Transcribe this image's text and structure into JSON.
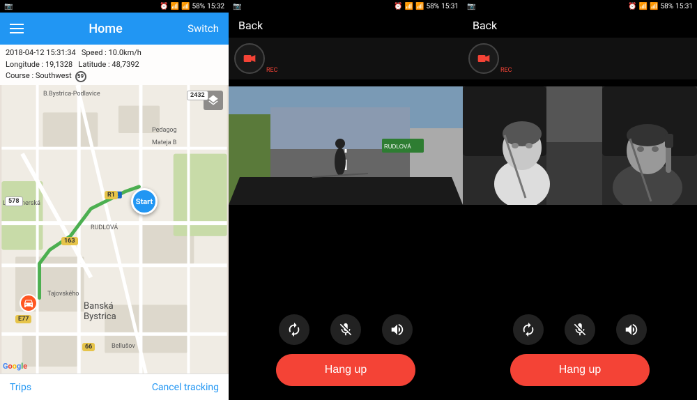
{
  "panel_map": {
    "status_bar": {
      "left": "",
      "time": "15:32",
      "battery": "58%"
    },
    "app_bar": {
      "title": "Home",
      "switch_label": "Switch"
    },
    "info": {
      "datetime": "2018-04-12  15:31:34",
      "speed_label": "Speed :",
      "speed_value": "10.0km/h",
      "longitude_label": "Longitude :",
      "longitude_value": "19,1328",
      "latitude_label": "Latitude :",
      "latitude_value": "48,7392",
      "course_label": "Course :",
      "course_value": "Southwest",
      "speed_badge": "59"
    },
    "start_label": "Start",
    "bottom": {
      "trips": "Trips",
      "cancel": "Cancel tracking"
    },
    "city": "Banská Bystrica",
    "place_labels": [
      "B.Bystrica-Podlavice",
      "RUDLOVÁ",
      "Pedagog",
      "Mateja B",
      "Laskomerská",
      "Tajovského",
      "Bellušov"
    ],
    "road_numbers": [
      "R1",
      "163",
      "E77",
      "578",
      "66",
      "2432"
    ],
    "google": "Google"
  },
  "panel_front": {
    "status_bar": {
      "time": "15:31",
      "battery": "58%"
    },
    "top_bar": {
      "back_label": "Back"
    },
    "rec_label": "REC",
    "controls": {
      "rotate_label": "rotate",
      "mic_label": "mic-off",
      "volume_label": "volume"
    },
    "hang_up": "Hang up"
  },
  "panel_interior": {
    "status_bar": {
      "time": "15:31",
      "battery": "58%"
    },
    "top_bar": {
      "back_label": "Back"
    },
    "rec_label": "REC",
    "controls": {
      "rotate_label": "rotate",
      "mic_label": "mic-off",
      "volume_label": "volume"
    },
    "hang_up": "Hang up"
  },
  "colors": {
    "accent": "#2196F3",
    "hang_up": "#f44336",
    "route": "#4CAF50",
    "car_marker": "#FF5722"
  }
}
